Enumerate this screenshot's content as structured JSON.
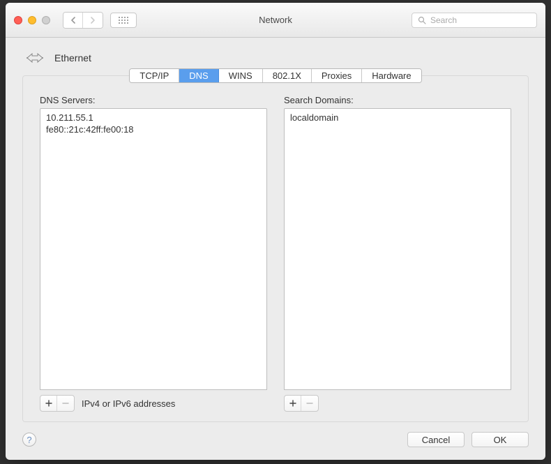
{
  "window": {
    "title": "Network"
  },
  "search": {
    "placeholder": "Search"
  },
  "header": {
    "interface_label": "Ethernet"
  },
  "tabs": {
    "tcpip": "TCP/IP",
    "dns": "DNS",
    "wins": "WINS",
    "dot1x": "802.1X",
    "proxies": "Proxies",
    "hardware": "Hardware",
    "active": "dns"
  },
  "dns_servers": {
    "label": "DNS Servers:",
    "items": [
      "10.211.55.1",
      "fe80::21c:42ff:fe00:18"
    ],
    "hint": "IPv4 or IPv6 addresses"
  },
  "search_domains": {
    "label": "Search Domains:",
    "items": [
      "localdomain"
    ]
  },
  "buttons": {
    "cancel": "Cancel",
    "ok": "OK",
    "help": "?"
  }
}
